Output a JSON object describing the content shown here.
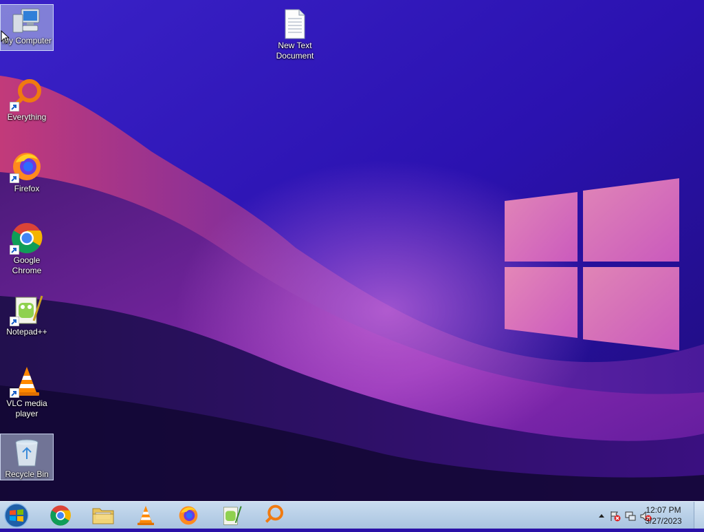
{
  "desktop": {
    "icons": [
      {
        "label": "My Computer",
        "icon": "computer-icon",
        "selected": true
      },
      {
        "label": "New Text Document",
        "icon": "text-document-icon"
      },
      {
        "label": "Everything",
        "icon": "everything-icon"
      },
      {
        "label": "Firefox",
        "icon": "firefox-icon"
      },
      {
        "label": "Google Chrome",
        "icon": "chrome-icon"
      },
      {
        "label": "Notepad++",
        "icon": "notepad-plus-plus-icon"
      },
      {
        "label": "VLC media player",
        "icon": "vlc-icon"
      },
      {
        "label": "Recycle Bin",
        "icon": "recycle-bin-icon",
        "selected": true
      }
    ]
  },
  "taskbar": {
    "pinned": [
      "start-orb-icon",
      "chrome-icon",
      "file-explorer-icon",
      "vlc-icon",
      "firefox-icon",
      "notepad-plus-plus-icon",
      "everything-icon"
    ],
    "clock": {
      "time": "12:07 PM",
      "date": "3/27/2023"
    },
    "tray_icons": [
      "show-hidden-icons-chevron",
      "action-center-flag-icon",
      "network-icon",
      "volume-muted-icon"
    ]
  },
  "colors": {
    "wallpaper_top": "#2d14b8",
    "wallpaper_bottom": "#12083a",
    "taskbar": "#b9d1ea",
    "windows_logo": "#f07ab8"
  }
}
